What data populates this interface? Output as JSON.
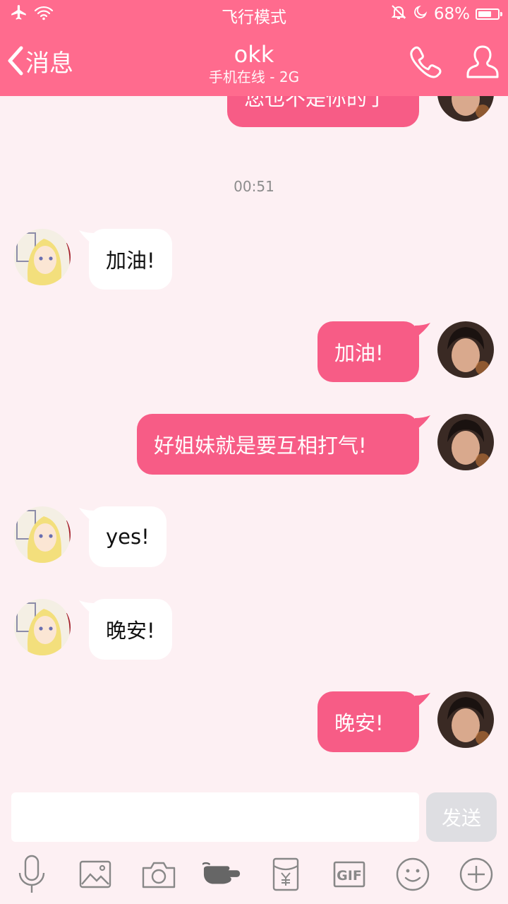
{
  "status_bar": {
    "title": "飞行模式",
    "battery_text": "68%",
    "battery_level": 0.68,
    "icons": [
      "airplane-icon",
      "wifi-icon",
      "mute-bell-icon",
      "moon-icon",
      "battery-icon"
    ]
  },
  "header": {
    "back_label": "消息",
    "contact_name": "okk",
    "contact_status": "手机在线 - 2G",
    "icons": [
      "chevron-left-icon",
      "phone-icon",
      "profile-icon"
    ]
  },
  "chat": {
    "partial_message": "您也不是你的了",
    "timestamp": "00:51",
    "messages": [
      {
        "side": "in",
        "text": "加油!"
      },
      {
        "side": "out",
        "text": "加油!"
      },
      {
        "side": "out",
        "text": "好姐妹就是要互相打气!"
      },
      {
        "side": "in",
        "text": "yes!"
      },
      {
        "side": "in",
        "text": "晚安!"
      },
      {
        "side": "out",
        "text": "晚安!"
      }
    ]
  },
  "input": {
    "value": "",
    "placeholder": "",
    "send_label": "发送"
  },
  "toolbar": {
    "gif_label": "GIF",
    "icons": [
      "microphone-icon",
      "image-icon",
      "camera-icon",
      "poke-hand-icon",
      "red-packet-icon",
      "gif-icon",
      "emoji-icon",
      "plus-icon"
    ]
  },
  "colors": {
    "accent": "#FF6B8E",
    "outgoing_bubble": "#F75C86",
    "incoming_bubble": "#FFFFFF",
    "chat_background": "#FDF0F3",
    "send_button": "#DEDEE2"
  }
}
